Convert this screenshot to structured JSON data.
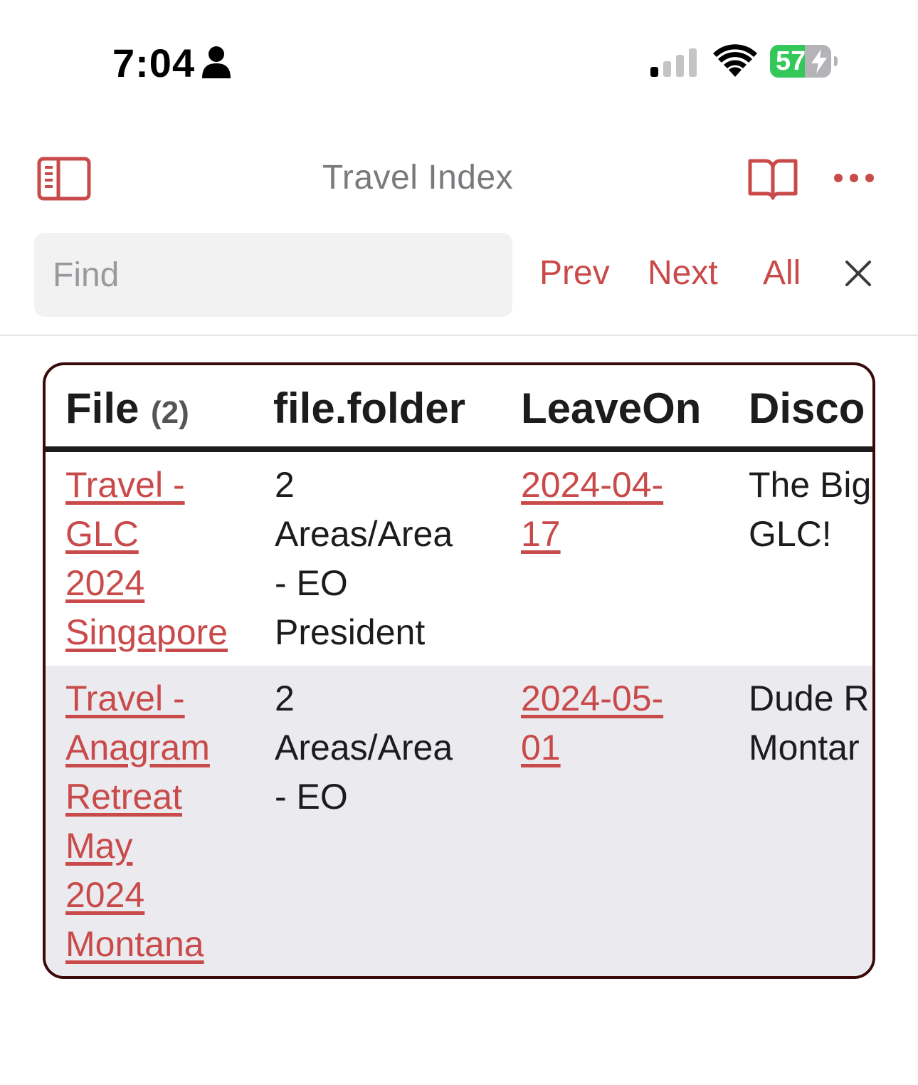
{
  "status_bar": {
    "time": "7:04",
    "battery_level": "57",
    "battery_fraction": 0.57,
    "icons": [
      "person-icon",
      "signal-icon",
      "wifi-icon",
      "battery-icon",
      "charging-bolt-icon"
    ]
  },
  "nav": {
    "title": "Travel Index",
    "icons": [
      "sidebar-toggle-icon",
      "reading-view-icon",
      "more-options-icon"
    ]
  },
  "find_bar": {
    "placeholder": "Find",
    "value": "",
    "prev_label": "Prev",
    "next_label": "Next",
    "all_label": "All",
    "close_icon": "close-icon"
  },
  "table": {
    "headers": {
      "file": "File",
      "file_count": "(2)",
      "folder": "file.folder",
      "leave_on": "LeaveOn",
      "discover": "Disco"
    },
    "rows": [
      {
        "file_lines": [
          "Travel - ",
          "GLC ",
          "2024 ",
          "Singapore"
        ],
        "folder_lines": [
          "2",
          "Areas/Area",
          "- EO",
          "President"
        ],
        "leave_on_lines": [
          "2024-04-",
          "17"
        ],
        "discover_lines": [
          "The Big",
          "GLC!"
        ]
      },
      {
        "file_lines": [
          "Travel - ",
          "Anagram ",
          "Retreat ",
          "May ",
          "2024 ",
          "Montana"
        ],
        "folder_lines": [
          "2",
          "Areas/Area",
          "- EO"
        ],
        "leave_on_lines": [
          "2024-05-",
          "01"
        ],
        "discover_lines": [
          "Dude R",
          "Montar"
        ]
      }
    ]
  },
  "colors": {
    "accent": "#c94a4a",
    "table_border": "#3a0a0a",
    "battery_green": "#34c759",
    "row_alt": "#ebebef"
  }
}
